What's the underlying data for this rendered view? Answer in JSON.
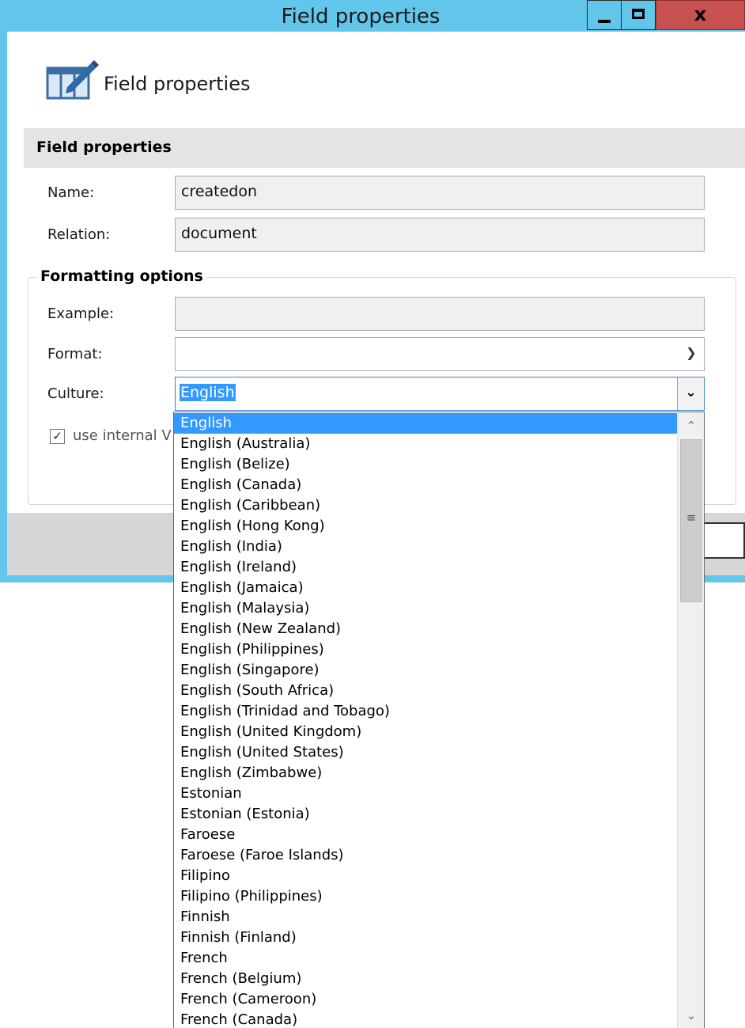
{
  "window": {
    "title": "Field properties"
  },
  "header": {
    "title": "Field properties"
  },
  "section": {
    "title": "Field properties"
  },
  "fields": {
    "name_label": "Name:",
    "name_value": "createdon",
    "relation_label": "Relation:",
    "relation_value": "document"
  },
  "formatting": {
    "group_title": "Formatting options",
    "example_label": "Example:",
    "example_value": "",
    "format_label": "Format:",
    "format_value": "",
    "culture_label": "Culture:",
    "culture_value": "English",
    "checkbox_label": "use internal V",
    "checkbox_checked": true
  },
  "culture_options": [
    "English",
    "English (Australia)",
    "English (Belize)",
    "English (Canada)",
    "English (Caribbean)",
    "English (Hong Kong)",
    "English (India)",
    "English (Ireland)",
    "English (Jamaica)",
    "English (Malaysia)",
    "English (New Zealand)",
    "English (Philippines)",
    "English (Singapore)",
    "English (South Africa)",
    "English (Trinidad and Tobago)",
    "English (United Kingdom)",
    "English (United States)",
    "English (Zimbabwe)",
    "Estonian",
    "Estonian (Estonia)",
    "Faroese",
    "Faroese (Faroe Islands)",
    "Filipino",
    "Filipino (Philippines)",
    "Finnish",
    "Finnish (Finland)",
    "French",
    "French (Belgium)",
    "French (Cameroon)",
    "French (Canada)"
  ],
  "selected_option_index": 0,
  "icons": {
    "window_minimize": "minimize-icon",
    "window_maximize": "maximize-icon",
    "window_close": "close-icon",
    "header": "field-properties-icon",
    "dropdown_arrow": "chevron-down-icon",
    "scroll_up": "chevron-up-icon",
    "scroll_down": "chevron-down-icon"
  },
  "colors": {
    "titlebar": "#62c5ea",
    "close_button": "#c75050",
    "selection": "#3399ff",
    "section_bar": "#e4e4e4"
  }
}
